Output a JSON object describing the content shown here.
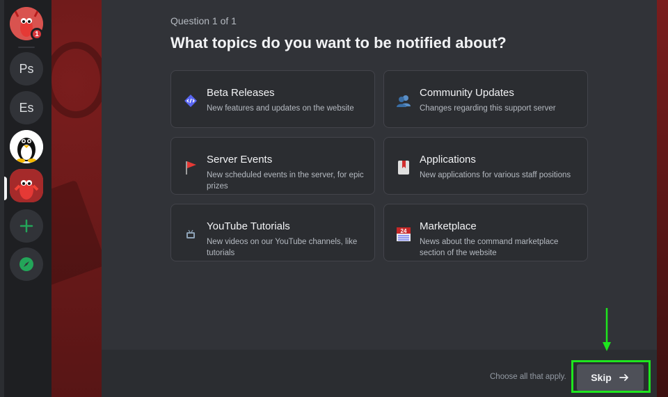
{
  "servers": {
    "items": [
      {
        "id": "lobster-server",
        "type": "avatar",
        "badge": "1"
      },
      {
        "id": "ps",
        "type": "text",
        "label": "Ps"
      },
      {
        "id": "es",
        "type": "text",
        "label": "Es"
      },
      {
        "id": "linux-server",
        "type": "avatar"
      },
      {
        "id": "lobster-server-selected",
        "type": "avatar",
        "selected": true
      },
      {
        "id": "add-server",
        "type": "action",
        "icon": "plus-icon"
      },
      {
        "id": "explore",
        "type": "action",
        "icon": "compass-icon"
      }
    ],
    "accent": "#23a559"
  },
  "modal": {
    "counter": "Question 1 of 1",
    "title": "What topics do you want to be notified about?",
    "options": [
      {
        "title": "Beta Releases",
        "desc": "New features and updates on the website",
        "icon": "code-icon"
      },
      {
        "title": "Community Updates",
        "desc": "Changes regarding this support server",
        "icon": "people-icon"
      },
      {
        "title": "Server Events",
        "desc": "New scheduled events in the server, for epic prizes",
        "icon": "red-flag-icon"
      },
      {
        "title": "Applications",
        "desc": "New applications for various staff positions",
        "icon": "bookmark-icon"
      },
      {
        "title": "YouTube Tutorials",
        "desc": "New videos on our YouTube channels, like tutorials",
        "icon": "tv-icon"
      },
      {
        "title": "Marketplace",
        "desc": "News about the command marketplace section of the website",
        "icon": "calendar-icon"
      }
    ],
    "footer": {
      "hint": "Choose all that apply.",
      "skip_label": "Skip"
    }
  },
  "annotation": {
    "color": "#1ee61e"
  }
}
